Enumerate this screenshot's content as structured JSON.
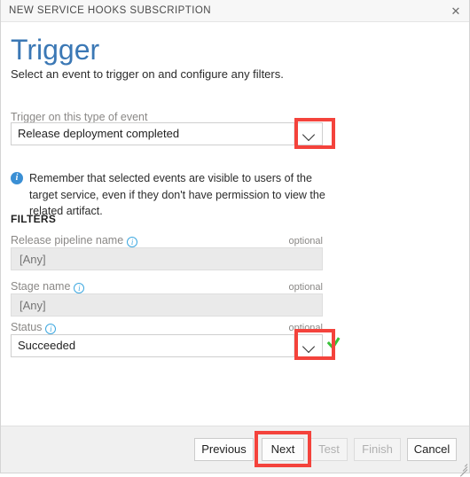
{
  "window": {
    "title": "NEW SERVICE HOOKS SUBSCRIPTION",
    "close_icon": "close-icon",
    "close_glyph": "✕",
    "resize_grip": "resize-grip-icon"
  },
  "page": {
    "heading": "Trigger",
    "subheading": "Select an event to trigger on and configure any filters."
  },
  "trigger": {
    "label": "Trigger on this type of event",
    "selected_value": "Release deployment completed",
    "chevron_icon": "chevron-down-icon"
  },
  "notice": {
    "icon": "info-circle-filled-icon",
    "glyph": "i",
    "text": "Remember that selected events are visible to users of the target service, even if they don't have permission to view the related artifact."
  },
  "filters": {
    "section_title": "FILTERS",
    "optional_tag": "optional",
    "info_glyph": "i",
    "fields": [
      {
        "label": "Release pipeline name",
        "info_icon": "info-circle-icon",
        "optional": "optional",
        "value": "",
        "placeholder": "[Any]",
        "type": "text"
      },
      {
        "label": "Stage name",
        "info_icon": "info-circle-icon",
        "optional": "optional",
        "value": "",
        "placeholder": "[Any]",
        "type": "text"
      },
      {
        "label": "Status",
        "info_icon": "info-circle-icon",
        "optional": "optional",
        "value": "Succeeded",
        "type": "select",
        "chevron_icon": "chevron-down-icon",
        "validation_icon": "green-check-icon"
      }
    ]
  },
  "footer": {
    "buttons": [
      {
        "label": "Previous",
        "disabled": false
      },
      {
        "label": "Next",
        "disabled": false
      },
      {
        "label": "Test",
        "disabled": true
      },
      {
        "label": "Finish",
        "disabled": true
      },
      {
        "label": "Cancel",
        "disabled": false
      }
    ]
  },
  "annotations": {
    "highlight_color": "#f4433c",
    "boxes": [
      "trigger-dropdown-chevron",
      "status-dropdown-chevron",
      "next-button"
    ]
  }
}
